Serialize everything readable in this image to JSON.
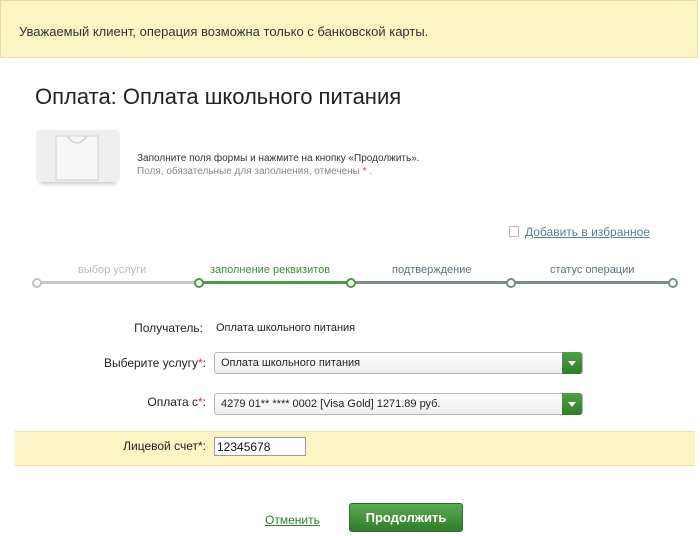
{
  "notice": {
    "text": "Уважаемый клиент, операция возможна только с банковской карты."
  },
  "page": {
    "title": "Оплата: Оплата школьного питания",
    "instruction": "Заполните поля формы и нажмите на кнопку «Продолжить».",
    "required_note": "Поля, обязательные для заполнения, отмечены",
    "required_mark": "*",
    "favorite_label": "Добавить в избранное"
  },
  "steps": [
    {
      "label": "выбор услуги",
      "state": "done"
    },
    {
      "label": "заполнение реквизитов",
      "state": "active"
    },
    {
      "label": "подтверждение",
      "state": "pending"
    },
    {
      "label": "статус операции",
      "state": "pending"
    }
  ],
  "form": {
    "recipient_label": "Получатель:",
    "recipient_value": "Оплата школьного питания",
    "service_label": "Выберите услугу",
    "service_value": "Оплата школьного питания",
    "payment_label": "Оплата с",
    "payment_value": "4279 01** **** 0002 [Visa Gold] 1271.89 руб.",
    "account_label": "Лицевой счет",
    "account_value": "12345678",
    "required_star": "*",
    "colon": ":"
  },
  "actions": {
    "cancel_label": "Отменить",
    "continue_label": "Продолжить"
  },
  "colors": {
    "accent_green": "#3d8f37",
    "notice_bg": "#fbf4c4",
    "link_blue": "#5a7e8c"
  },
  "icons": {
    "service_tile": "shopping-bag-icon",
    "favorite": "checkbox-icon",
    "dropdown": "chevron-down-icon"
  }
}
